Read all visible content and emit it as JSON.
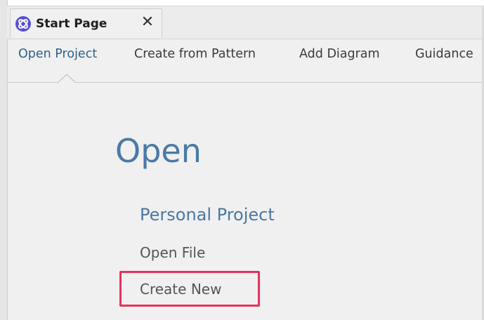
{
  "tab": {
    "label": "Start Page",
    "icon": "start-page-icon",
    "close_glyph": "✕"
  },
  "nav": {
    "items": [
      {
        "label": "Open Project",
        "active": true
      },
      {
        "label": "Create from Pattern",
        "active": false
      },
      {
        "label": "Add Diagram",
        "active": false
      },
      {
        "label": "Guidance",
        "active": false
      }
    ]
  },
  "main": {
    "heading": "Open",
    "subheading": "Personal Project",
    "links": [
      "Open File",
      "Create New"
    ],
    "highlighted_link": "Create New"
  },
  "colors": {
    "accent": "#4a79a8",
    "highlight_border": "#e6335b",
    "background": "#f0f0f0"
  }
}
